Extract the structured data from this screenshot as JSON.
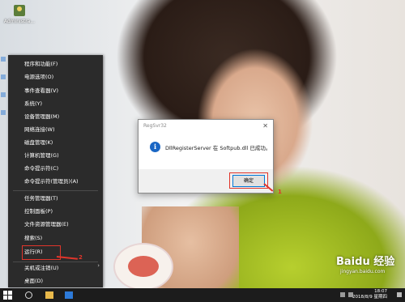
{
  "desktop": {
    "icon_label": "Administra..."
  },
  "start_menu": {
    "items": [
      {
        "label": "程序和功能(F)"
      },
      {
        "label": "电源选项(O)"
      },
      {
        "label": "事件查看器(V)"
      },
      {
        "label": "系统(Y)"
      },
      {
        "label": "设备管理器(M)"
      },
      {
        "label": "网络连接(W)"
      },
      {
        "label": "磁盘管理(K)"
      },
      {
        "label": "计算机管理(G)"
      },
      {
        "label": "命令提示符(C)"
      },
      {
        "label": "命令提示符(管理员)(A)"
      },
      {
        "label": "任务管理器(T)"
      },
      {
        "label": "控制面板(P)"
      },
      {
        "label": "文件资源管理器(E)"
      },
      {
        "label": "搜索(S)"
      },
      {
        "label": "运行(R)"
      },
      {
        "label": "关机或注销(U)"
      },
      {
        "label": "桌面(D)"
      }
    ],
    "submenu_arrow": "›"
  },
  "dialog": {
    "title": "RegSvr32",
    "close_glyph": "✕",
    "info_glyph": "i",
    "message": "DllRegisterServer 在 Softpub.dll 已成功。",
    "ok_label": "确定"
  },
  "annotations": {
    "step1": "1",
    "step2": "2"
  },
  "watermark": {
    "brand": "Baidu 经验",
    "url": "jingyan.baidu.com"
  },
  "taskbar": {
    "time": "18:07",
    "date": "2018/8/9 星期四"
  },
  "colors": {
    "annotation_red": "#e0352b",
    "menu_bg": "#2b2b2b",
    "taskbar_bg": "#1c1c1c",
    "info_blue": "#1a66c4"
  }
}
